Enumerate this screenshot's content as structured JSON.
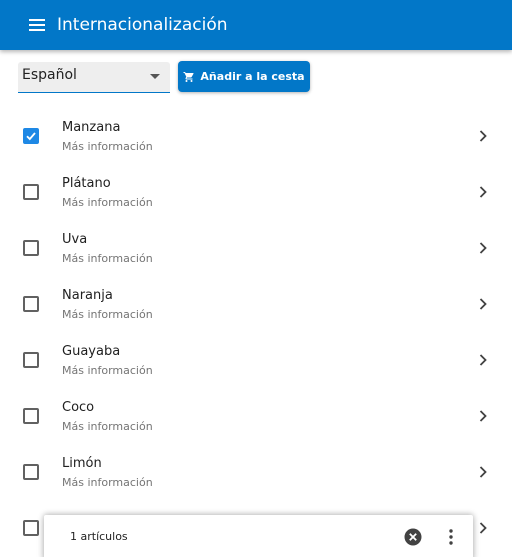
{
  "header": {
    "title": "Internacionalización",
    "menu_icon": "menu-icon"
  },
  "toolbar": {
    "language_selected": "Español",
    "cart_button_label": "Añadir a la cesta",
    "cart_icon": "shopping-cart-icon"
  },
  "list": {
    "items": [
      {
        "title": "Manzana",
        "subtitle": "Más información",
        "checked": true
      },
      {
        "title": "Plátano",
        "subtitle": "Más información",
        "checked": false
      },
      {
        "title": "Uva",
        "subtitle": "Más información",
        "checked": false
      },
      {
        "title": "Naranja",
        "subtitle": "Más información",
        "checked": false
      },
      {
        "title": "Guayaba",
        "subtitle": "Más información",
        "checked": false
      },
      {
        "title": "Coco",
        "subtitle": "Más información",
        "checked": false
      },
      {
        "title": "Limón",
        "subtitle": "Más información",
        "checked": false
      },
      {
        "title": "",
        "subtitle": "",
        "checked": false
      }
    ]
  },
  "toast": {
    "message": "1 artículos",
    "close_icon": "close-circle-icon",
    "more_icon": "more-vertical-icon"
  },
  "colors": {
    "primary": "#0277c8",
    "checkbox_checked": "#1e88e5"
  }
}
